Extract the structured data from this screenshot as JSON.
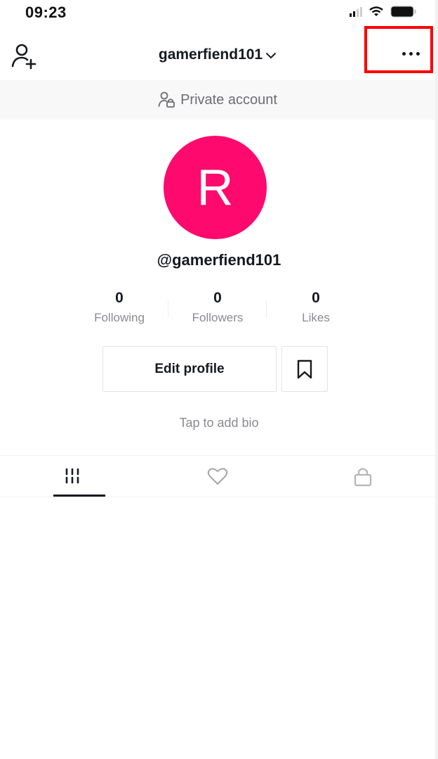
{
  "status_bar": {
    "time": "09:23",
    "icons": [
      "cellular-signal-icon",
      "wifi-icon",
      "battery-icon"
    ]
  },
  "header": {
    "username": "gamerfiend101",
    "add_user_icon": "person-add-icon",
    "dropdown_icon": "chevron-down-icon",
    "more_icon": "more-horizontal-icon",
    "highlight_color": "#ff0000"
  },
  "private_banner": {
    "icon": "private-person-lock-icon",
    "label": "Private account"
  },
  "profile": {
    "avatar_letter": "R",
    "avatar_color": "#fe0a6f",
    "handle": "@gamerfiend101",
    "stats": [
      {
        "value": "0",
        "label": "Following"
      },
      {
        "value": "0",
        "label": "Followers"
      },
      {
        "value": "0",
        "label": "Likes"
      }
    ],
    "edit_profile_label": "Edit profile",
    "bookmark_icon": "bookmark-icon",
    "bio_placeholder": "Tap to add bio"
  },
  "tabs": [
    {
      "icon": "videos-grid-icon",
      "active": true
    },
    {
      "icon": "heart-icon",
      "active": false
    },
    {
      "icon": "lock-icon",
      "active": false
    }
  ]
}
